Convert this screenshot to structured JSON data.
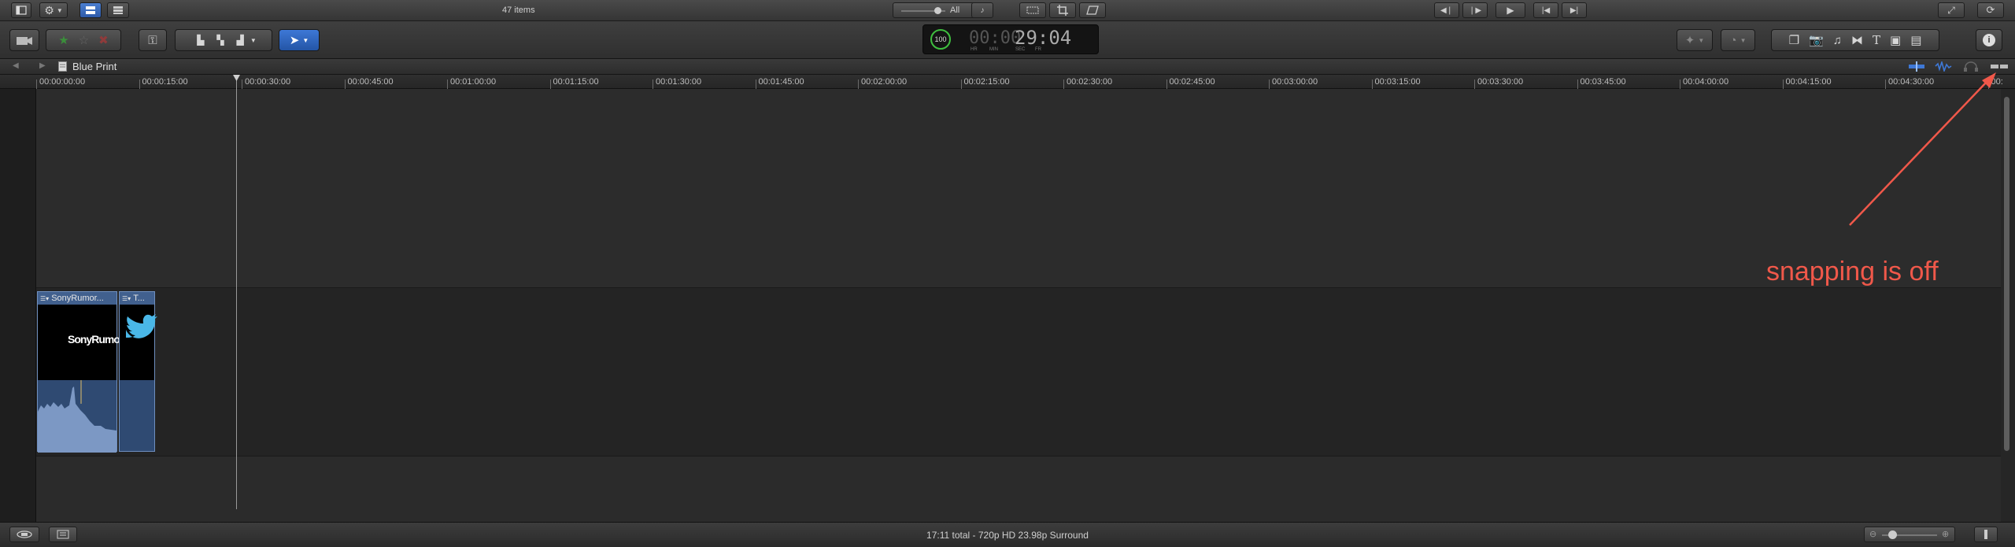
{
  "browser": {
    "items_count": "47 items",
    "filter_label": "All"
  },
  "timecode": {
    "small": "00:00",
    "large": "29:04",
    "units": [
      "HR",
      "MIN",
      "SEC",
      "FR"
    ],
    "percent": "100"
  },
  "timeline": {
    "project_name": "Blue Print",
    "ruler_labels": [
      "00:00:00:00",
      "00:00:15:00",
      "00:00:30:00",
      "00:00:45:00",
      "00:01:00:00",
      "00:01:15:00",
      "00:01:30:00",
      "00:01:45:00",
      "00:02:00:00",
      "00:02:15:00",
      "00:02:30:00",
      "00:02:45:00",
      "00:03:00:00",
      "00:03:15:00",
      "00:03:30:00",
      "00:03:45:00",
      "00:04:00:00",
      "00:04:15:00",
      "00:04:30:00",
      "00:"
    ],
    "clips": [
      {
        "title": "SonyRumor...",
        "thumb_text": "SonyRumo"
      },
      {
        "title": "T..."
      }
    ]
  },
  "status": {
    "summary": "17:11 total - 720p HD 23.98p Surround"
  },
  "annotation": {
    "text": "snapping is off",
    "color": "#f0584a"
  },
  "colors": {
    "accent_blue": "#3e78d6",
    "clip_blue": "#3d5d8a",
    "timecode_green": "#3fbf3f"
  }
}
